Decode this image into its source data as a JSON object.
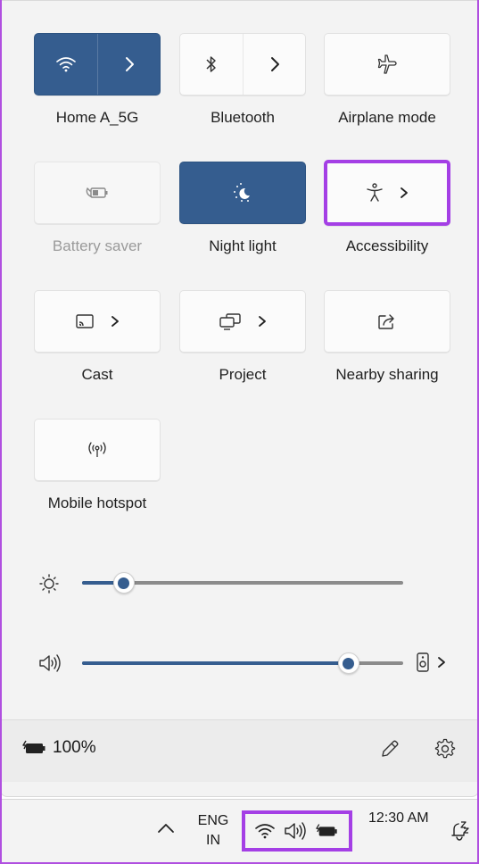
{
  "tiles": [
    {
      "id": "wifi",
      "label": "Home A_5G",
      "state": "on",
      "icon": "wifi-icon",
      "expand": true
    },
    {
      "id": "bluetooth",
      "label": "Bluetooth",
      "state": "off",
      "icon": "bluetooth-icon",
      "expand": true
    },
    {
      "id": "airplane",
      "label": "Airplane mode",
      "state": "off",
      "icon": "airplane-icon",
      "expand": false
    },
    {
      "id": "battery-saver",
      "label": "Battery saver",
      "state": "disabled",
      "icon": "battery-saver-icon",
      "expand": false
    },
    {
      "id": "night-light",
      "label": "Night light",
      "state": "on",
      "icon": "night-light-icon",
      "expand": false
    },
    {
      "id": "accessibility",
      "label": "Accessibility",
      "state": "off",
      "icon": "accessibility-icon",
      "expand": true
    },
    {
      "id": "cast",
      "label": "Cast",
      "state": "off",
      "icon": "cast-icon",
      "expand": true
    },
    {
      "id": "project",
      "label": "Project",
      "state": "off",
      "icon": "project-icon",
      "expand": true
    },
    {
      "id": "nearby-sharing",
      "label": "Nearby sharing",
      "state": "off",
      "icon": "share-icon",
      "expand": false
    },
    {
      "id": "mobile-hotspot",
      "label": "Mobile hotspot",
      "state": "off",
      "icon": "hotspot-icon",
      "expand": false
    }
  ],
  "brightness": {
    "icon": "brightness-icon",
    "value": 0.13
  },
  "volume": {
    "icon": "speaker-icon",
    "value": 0.83,
    "output_icon": "speaker-device-icon"
  },
  "footer": {
    "battery_icon": "battery-charging-icon",
    "battery_text": "100%",
    "edit_icon": "pencil-icon",
    "settings_icon": "gear-icon"
  },
  "taskbar": {
    "chevron_icon": "chevron-up-icon",
    "lang_line1": "ENG",
    "lang_line2": "IN",
    "tray_icons": [
      "wifi-icon",
      "speaker-icon",
      "battery-charging-icon"
    ],
    "time": "12:30 AM",
    "notification_icon": "notification-snooze-icon"
  },
  "colors": {
    "accent": "#355d8f",
    "highlight": "#a43fe5"
  }
}
